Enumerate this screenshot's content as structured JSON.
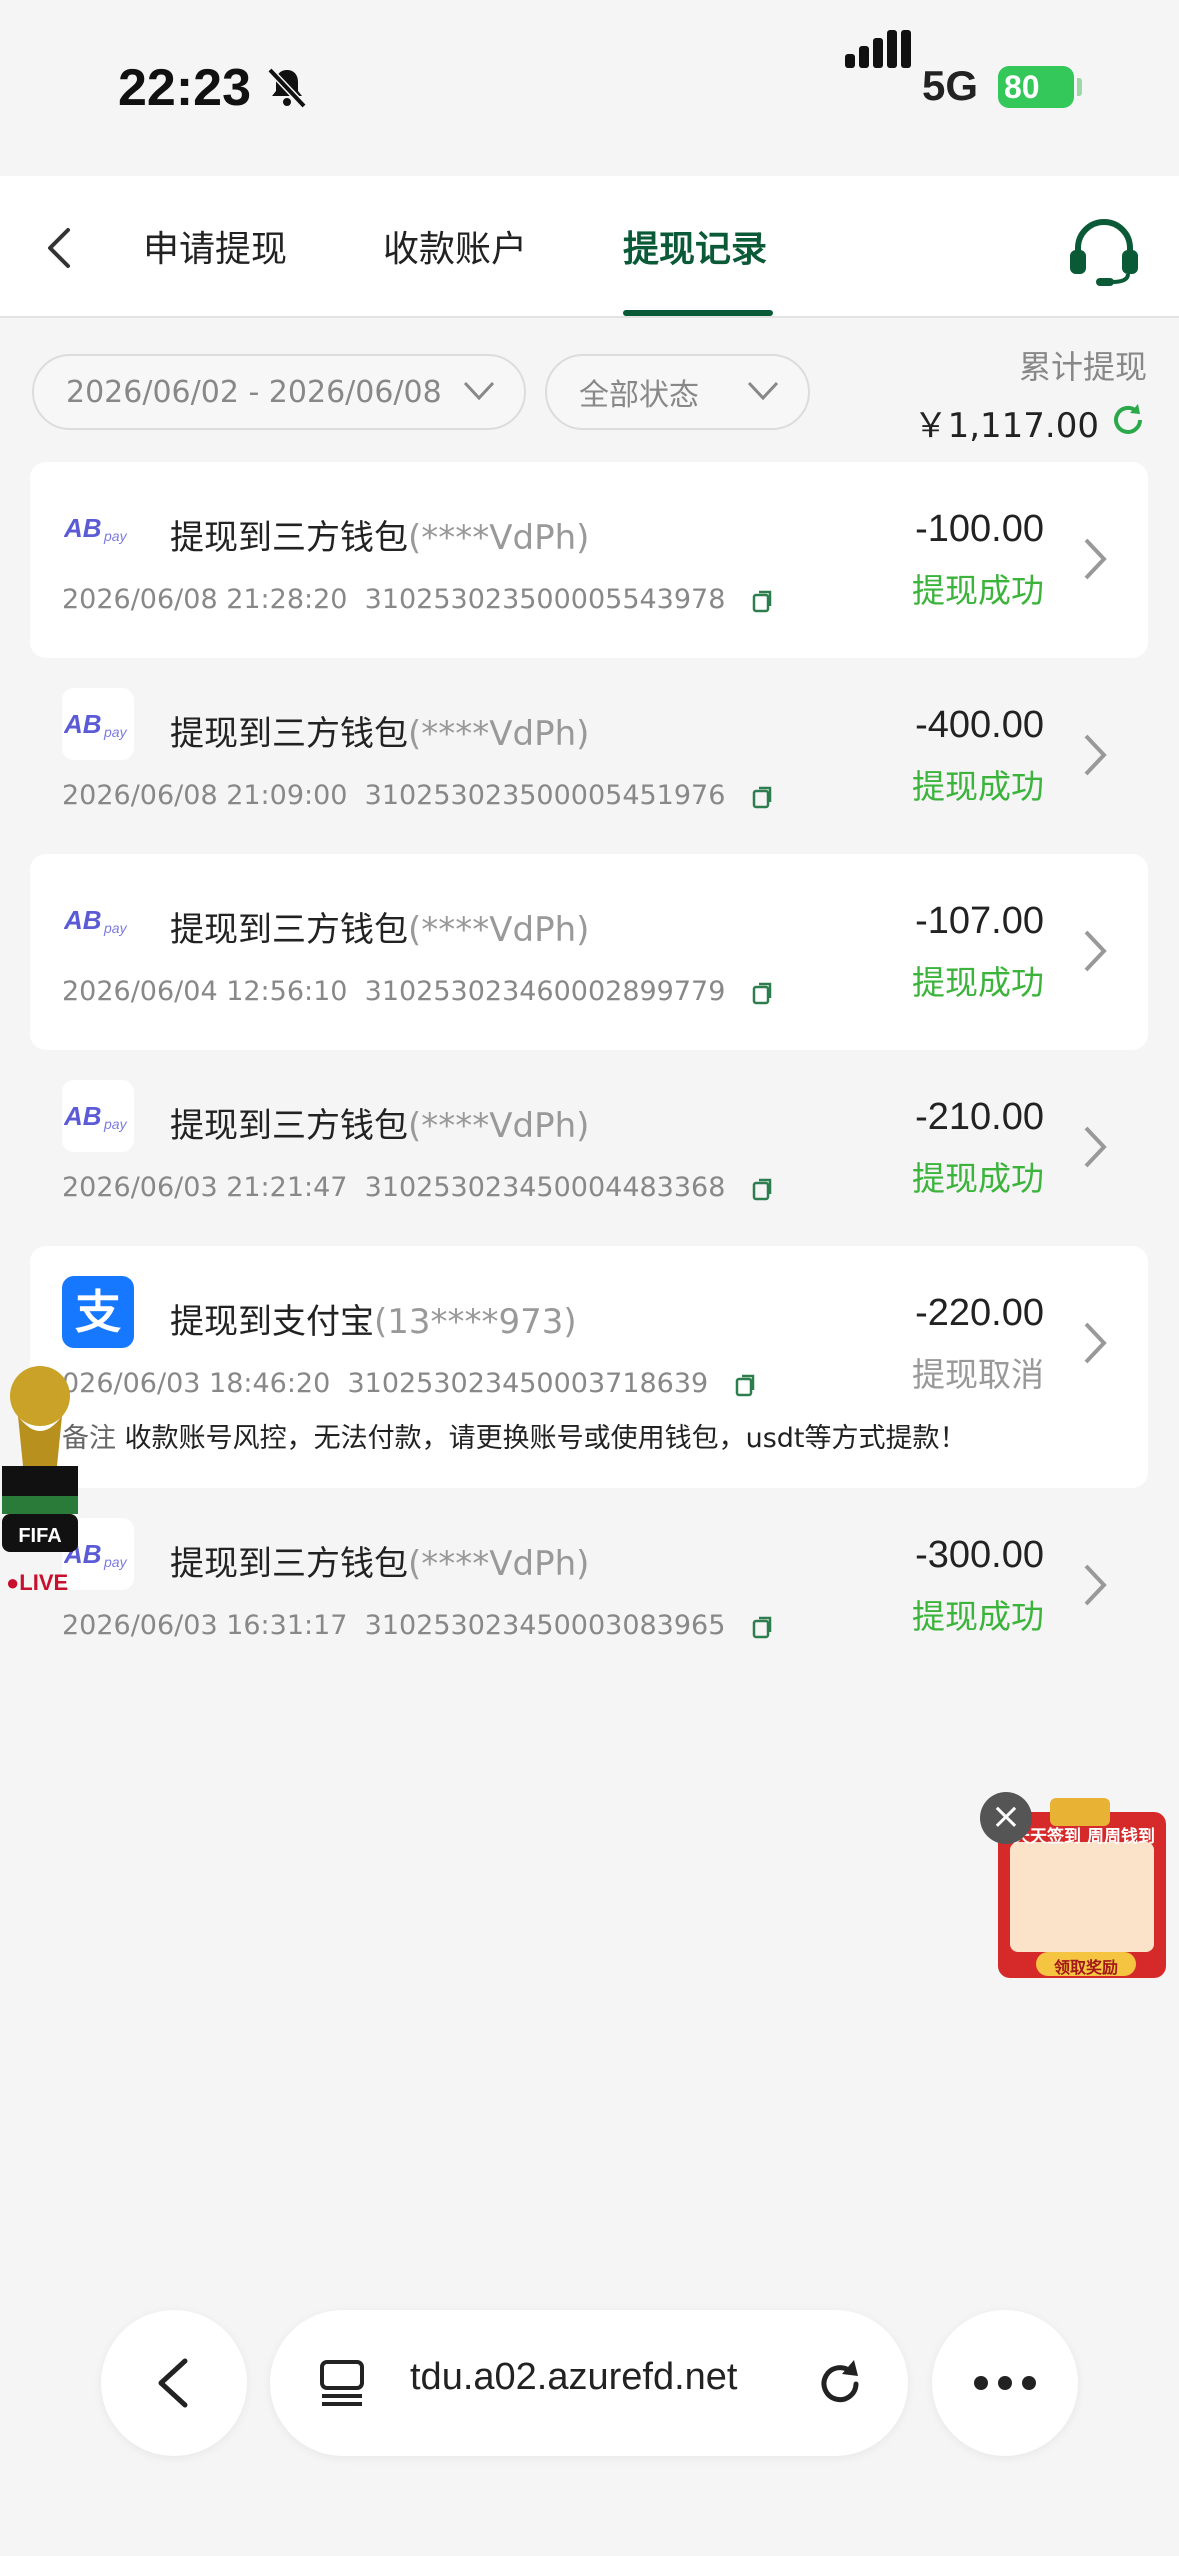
{
  "status_bar": {
    "time": "22:23",
    "network": "5G",
    "battery": "80"
  },
  "tabs": [
    {
      "label": "申请提现"
    },
    {
      "label": "收款账户"
    },
    {
      "label": "提现记录"
    }
  ],
  "filters": {
    "date_range": "2026/06/02 - 2026/06/08",
    "status": "全部状态"
  },
  "summary": {
    "label": "累计提现",
    "value": "￥1,117.00"
  },
  "records": [
    {
      "title": "提现到三方钱包",
      "account": "(****VdPh)",
      "datetime": "2026/06/08 21:28:20",
      "order_no": "310253023500005543978",
      "amount": "-100.00",
      "status": "提现成功",
      "icon": "abpay-icon"
    },
    {
      "title": "提现到三方钱包",
      "account": "(****VdPh)",
      "datetime": "2026/06/08 21:09:00",
      "order_no": "310253023500005451976",
      "amount": "-400.00",
      "status": "提现成功",
      "icon": "abpay-icon"
    },
    {
      "title": "提现到三方钱包",
      "account": "(****VdPh)",
      "datetime": "2026/06/04 12:56:10",
      "order_no": "310253023460002899779",
      "amount": "-107.00",
      "status": "提现成功",
      "icon": "abpay-icon"
    },
    {
      "title": "提现到三方钱包",
      "account": "(****VdPh)",
      "datetime": "2026/06/03 21:21:47",
      "order_no": "310253023450004483368",
      "amount": "-210.00",
      "status": "提现成功",
      "icon": "abpay-icon"
    },
    {
      "title": "提现到支付宝",
      "account": "(13****973)",
      "datetime": "026/06/03 18:46:20",
      "order_no": "310253023450003718639",
      "amount": "-220.00",
      "status": "提现取消",
      "icon": "alipay-icon",
      "note_label": "备注",
      "note": "收款账号风控，无法付款，请更换账号或使用钱包，usdt等方式提款！"
    },
    {
      "title": "提现到三方钱包",
      "account": "(****VdPh)",
      "datetime": "2026/06/03 16:31:17",
      "order_no": "310253023450003083965",
      "amount": "-300.00",
      "status": "提现成功",
      "icon": "abpay-icon"
    }
  ],
  "floating": {
    "live": "LIVE",
    "fifa": "FIFA"
  },
  "promo": {
    "title": "天天签到 周周钱到",
    "button": "领取奖励"
  },
  "browser": {
    "url": "tdu.a02.azurefd.net"
  },
  "colors": {
    "brand_green": "#0b5a37",
    "success": "#3cb43c",
    "cancel": "#999999",
    "alipay": "#1677ff"
  }
}
